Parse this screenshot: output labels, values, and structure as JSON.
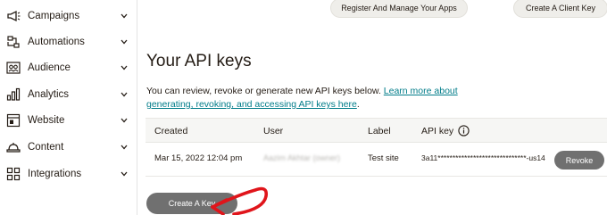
{
  "sidebar": {
    "items": [
      {
        "label": "Campaigns",
        "icon": "megaphone-icon"
      },
      {
        "label": "Automations",
        "icon": "automation-icon"
      },
      {
        "label": "Audience",
        "icon": "audience-icon"
      },
      {
        "label": "Analytics",
        "icon": "bar-chart-icon"
      },
      {
        "label": "Website",
        "icon": "website-icon"
      },
      {
        "label": "Content",
        "icon": "content-icon"
      },
      {
        "label": "Integrations",
        "icon": "integrations-icon"
      }
    ]
  },
  "header": {
    "register_label": "Register And Manage Your Apps",
    "client_key_label": "Create A Client Key"
  },
  "main": {
    "title": "Your API keys",
    "desc_text": "You can review, revoke or generate new API keys below. ",
    "desc_link": "Learn more about generating, revoking, and accessing API keys here",
    "desc_end": "."
  },
  "table": {
    "headers": {
      "created": "Created",
      "user": "User",
      "label": "Label",
      "api_key": "API key"
    },
    "rows": [
      {
        "created": "Mar 15, 2022 12:04 pm",
        "user": "Aazim Akhtar (owner)",
        "label": "Test site",
        "api_key": "3a11******************************-us14",
        "revoke_label": "Revoke"
      }
    ]
  },
  "create_key_label": "Create A Key",
  "colors": {
    "accent": "#007c89",
    "button": "#707070",
    "annotation": "#e0151b"
  }
}
